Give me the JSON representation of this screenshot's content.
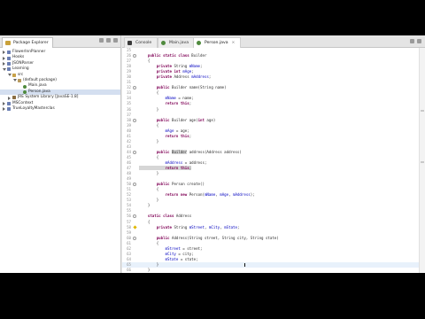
{
  "explorer": {
    "title": "Package Explorer",
    "items": [
      {
        "label": "FlowerInnPlanner",
        "level": 0,
        "icon": "project-icon",
        "twisty": "closed",
        "selected": false
      },
      {
        "label": "Hooks",
        "level": 0,
        "icon": "project-icon",
        "twisty": "closed",
        "selected": false
      },
      {
        "label": "JSONParser",
        "level": 0,
        "icon": "project-icon",
        "twisty": "closed",
        "selected": false
      },
      {
        "label": "Learning",
        "level": 0,
        "icon": "project-icon",
        "twisty": "open",
        "selected": false
      },
      {
        "label": "src",
        "level": 1,
        "icon": "source-folder-icon",
        "twisty": "open",
        "selected": false
      },
      {
        "label": "(default package)",
        "level": 2,
        "icon": "package-icon",
        "twisty": "open",
        "selected": false
      },
      {
        "label": "Main.java",
        "level": 3,
        "icon": "java-file-icon",
        "twisty": "closed",
        "selected": false
      },
      {
        "label": "Person.java",
        "level": 3,
        "icon": "java-file-icon",
        "twisty": "closed",
        "selected": true
      },
      {
        "label": "JRE System Library [JavaSE-1.8]",
        "level": 1,
        "icon": "library-icon",
        "twisty": "closed",
        "selected": false
      },
      {
        "label": "MSContext",
        "level": 0,
        "icon": "project-icon",
        "twisty": "closed",
        "selected": false
      },
      {
        "label": "TrueLoyaltyMasterclas",
        "level": 0,
        "icon": "project-icon",
        "twisty": "closed",
        "selected": false
      }
    ]
  },
  "editor": {
    "tabs": [
      {
        "label": "Console",
        "active": false,
        "icon": "console-icon"
      },
      {
        "label": "Main.java",
        "active": false,
        "icon": "java-file-icon"
      },
      {
        "label": "Person.java",
        "active": true,
        "icon": "java-file-icon"
      }
    ],
    "lines": [
      {
        "n": "25",
        "g": "",
        "t": ""
      },
      {
        "n": "26",
        "g": "fold",
        "t": "    public static class Builder"
      },
      {
        "n": "27",
        "g": "",
        "t": "    {"
      },
      {
        "n": "28",
        "g": "",
        "t": "        private String mName;"
      },
      {
        "n": "29",
        "g": "",
        "t": "        private int mAge;"
      },
      {
        "n": "30",
        "g": "",
        "t": "        private Address mAddress;"
      },
      {
        "n": "31",
        "g": "",
        "t": ""
      },
      {
        "n": "32",
        "g": "fold",
        "t": "        public Builder name(String name)"
      },
      {
        "n": "33",
        "g": "",
        "t": "        {"
      },
      {
        "n": "34",
        "g": "",
        "t": "            mName = name;"
      },
      {
        "n": "35",
        "g": "",
        "t": "            return this;"
      },
      {
        "n": "36",
        "g": "",
        "t": "        }"
      },
      {
        "n": "37",
        "g": "",
        "t": ""
      },
      {
        "n": "38",
        "g": "fold",
        "t": "        public Builder age(int age)"
      },
      {
        "n": "39",
        "g": "",
        "t": "        {"
      },
      {
        "n": "40",
        "g": "",
        "t": "            mAge = age;"
      },
      {
        "n": "41",
        "g": "",
        "t": "            return this;"
      },
      {
        "n": "42",
        "g": "",
        "t": "        }"
      },
      {
        "n": "43",
        "g": "",
        "t": ""
      },
      {
        "n": "44",
        "g": "fold",
        "t": "        public Builder address(Address address)"
      },
      {
        "n": "45",
        "g": "",
        "t": "        {"
      },
      {
        "n": "46",
        "g": "",
        "t": "            mAddress = address;"
      },
      {
        "n": "47",
        "g": "",
        "t": "            return this;"
      },
      {
        "n": "48",
        "g": "",
        "t": "        }"
      },
      {
        "n": "49",
        "g": "",
        "t": ""
      },
      {
        "n": "50",
        "g": "fold",
        "t": "        public Person create()"
      },
      {
        "n": "51",
        "g": "",
        "t": "        {"
      },
      {
        "n": "52",
        "g": "",
        "t": "            return new Person(mName, mAge, mAddress);"
      },
      {
        "n": "53",
        "g": "",
        "t": "        }"
      },
      {
        "n": "54",
        "g": "",
        "t": "    }"
      },
      {
        "n": "55",
        "g": "",
        "t": ""
      },
      {
        "n": "56",
        "g": "fold",
        "t": "    static class Address"
      },
      {
        "n": "57",
        "g": "",
        "t": "    {"
      },
      {
        "n": "58",
        "g": "warn",
        "t": "        private String mStreet, mCity, mState;"
      },
      {
        "n": "59",
        "g": "",
        "t": ""
      },
      {
        "n": "60",
        "g": "fold",
        "t": "        public Address(String street, String city, String state)"
      },
      {
        "n": "61",
        "g": "",
        "t": "        {"
      },
      {
        "n": "62",
        "g": "",
        "t": "            mStreet = street;"
      },
      {
        "n": "63",
        "g": "",
        "t": "            mCity = city;"
      },
      {
        "n": "64",
        "g": "",
        "t": "            mState = state;"
      },
      {
        "n": "65",
        "g": "",
        "t": "        }"
      },
      {
        "n": "66",
        "g": "",
        "t": "    }"
      },
      {
        "n": "67",
        "g": "",
        "t": "}"
      },
      {
        "n": "68",
        "g": "",
        "t": ""
      }
    ],
    "current_line": "65",
    "highlight_word": "Builder",
    "highlight_line": "44",
    "highlight_return_line": "47"
  },
  "colors": {
    "keyword": "#7f0055",
    "field": "#0000c0",
    "selection": "#d4dff0",
    "current_line": "#e8f1fb"
  }
}
